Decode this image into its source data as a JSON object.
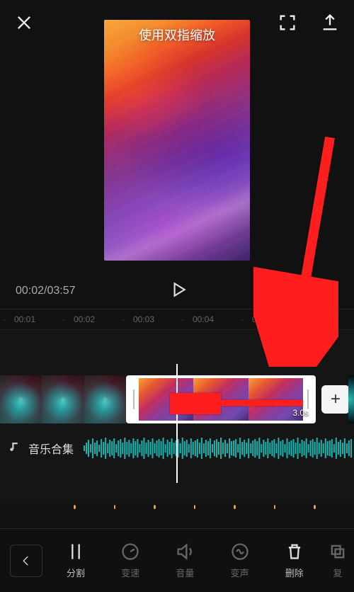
{
  "hint": "使用双指缩放",
  "time": {
    "current": "00:02",
    "total": "03:57"
  },
  "ruler": [
    "00:01",
    "00:02",
    "00:03",
    "00:04",
    "00:0"
  ],
  "selectedClip": {
    "duration": "3.0s"
  },
  "addBtn": "+",
  "audio": {
    "label": "音乐合集"
  },
  "tools": {
    "split": "分割",
    "speed": "变速",
    "volume": "音量",
    "voice": "变声",
    "delete": "删除",
    "restore": "复"
  }
}
